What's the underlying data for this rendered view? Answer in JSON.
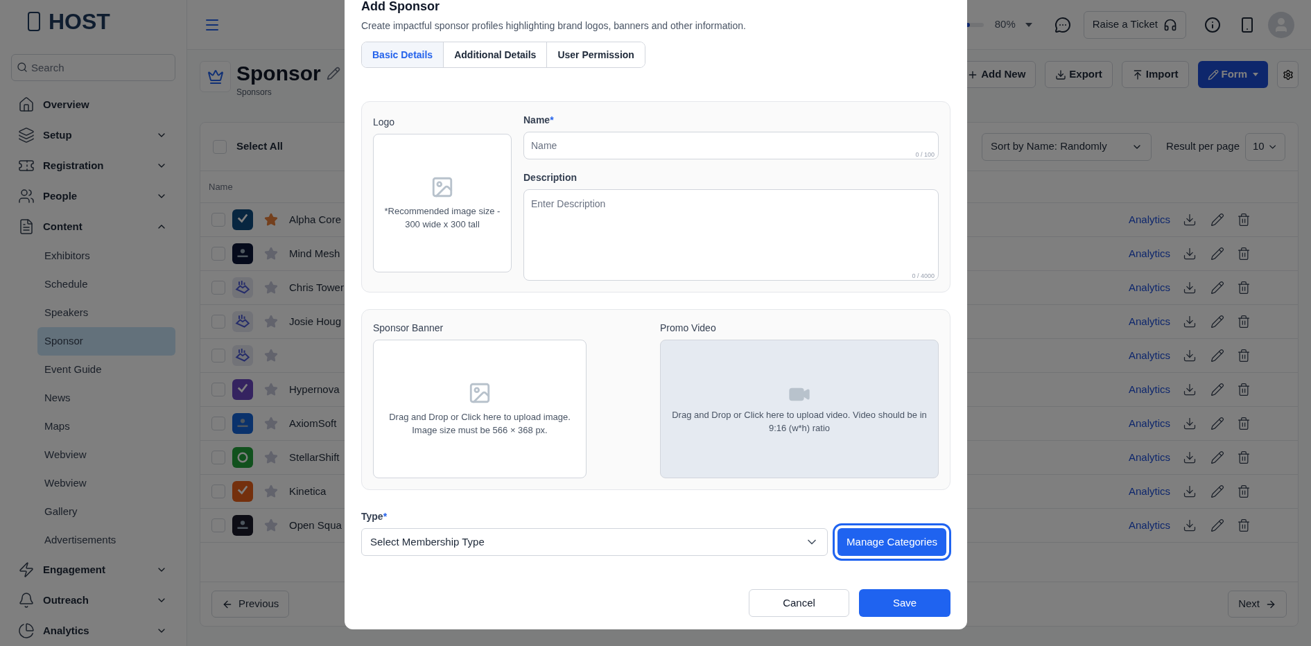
{
  "sidebar": {
    "brand": "HOST",
    "search": {
      "placeholder": "Search"
    },
    "items": [
      {
        "label": "Overview"
      },
      {
        "label": "Setup",
        "expanded": false
      },
      {
        "label": "Registration",
        "expanded": false
      },
      {
        "label": "People",
        "expanded": false
      },
      {
        "label": "Content",
        "expanded": true,
        "children": [
          {
            "label": "Exhibitors",
            "selected": false
          },
          {
            "label": "Schedule",
            "selected": false
          },
          {
            "label": "Speakers",
            "selected": false
          },
          {
            "label": "Sponsor",
            "selected": true
          },
          {
            "label": "Event Guide",
            "selected": false
          },
          {
            "label": "News",
            "selected": false
          },
          {
            "label": "Maps",
            "selected": false
          },
          {
            "label": "Webview",
            "selected": false
          },
          {
            "label": "Webview",
            "selected": false
          },
          {
            "label": "Gallery",
            "selected": false
          },
          {
            "label": "Advertisements",
            "selected": false
          }
        ]
      },
      {
        "label": "Engagement",
        "expanded": false
      },
      {
        "label": "Outreach",
        "expanded": false
      },
      {
        "label": "Analytics",
        "expanded": false
      }
    ]
  },
  "topbar": {
    "zoom": {
      "level": 0.8,
      "reading": "80%"
    },
    "ticket_button": "Raise a Ticket"
  },
  "page": {
    "title": "Sponsor",
    "subtitle": "Sponsors",
    "actions": [
      {
        "label": "Add New",
        "kind": "add"
      },
      {
        "label": "Export",
        "kind": "export"
      },
      {
        "label": "Import",
        "kind": "import"
      },
      {
        "label": "Form",
        "kind": "primary"
      }
    ]
  },
  "table": {
    "select_all": {
      "label": "Select All",
      "checked": false
    },
    "sort": "Sort by Name: Randomly",
    "per_page_label": "Result per page",
    "per_page": "10",
    "columns": [
      "Name"
    ],
    "rows": [
      {
        "name": "Alpha Core",
        "checked": false,
        "starred": true,
        "action": "Analytics"
      },
      {
        "name": "Mind Mesh",
        "checked": false,
        "starred": false,
        "action": "Analytics"
      },
      {
        "name": "Chris Tower",
        "checked": false,
        "starred": false,
        "action": "Analytics"
      },
      {
        "name": "Josie Houg",
        "checked": false,
        "starred": false,
        "action": "Analytics"
      },
      {
        "checked": false,
        "starred": false,
        "action": "Analytics"
      },
      {
        "name": "Hypernova",
        "checked": false,
        "starred": false,
        "action": "Analytics"
      },
      {
        "name": "AxiomSoft",
        "checked": false,
        "starred": false,
        "action": "Analytics"
      },
      {
        "name": "StellarShift",
        "checked": false,
        "starred": false,
        "action": "Analytics"
      },
      {
        "name": "Kinetica",
        "checked": false,
        "starred": false,
        "action": "Analytics"
      },
      {
        "name": "Open Squa",
        "checked": false,
        "starred": false,
        "action": "Analytics"
      }
    ],
    "previous": "Previous",
    "next": "Next"
  },
  "modal": {
    "title": "Add Sponsor",
    "subtitle": "Create impactful sponsor profiles highlighting brand logos, banners and other information.",
    "tabs": [
      {
        "label": "Basic Details",
        "selected": true
      },
      {
        "label": "Additional Details",
        "selected": false
      },
      {
        "label": "User Permission",
        "selected": false
      }
    ],
    "logo": {
      "label": "Logo",
      "hint": "*Recommended image size - 300 wide x 300 tall"
    },
    "name": {
      "label": "Name",
      "asterisk": "*",
      "placeholder": "Name",
      "counter": "0 / 100"
    },
    "description": {
      "label": "Description",
      "placeholder": "Enter Description",
      "counter": "0 / 4000"
    },
    "banner": {
      "label": "Sponsor Banner",
      "hint": "Drag and Drop or Click here to upload image. Image size must be 566 × 368 px."
    },
    "video": {
      "label": "Promo Video",
      "hint": "Drag and Drop or Click here to upload video. Video should be in 9:16 (w*h) ratio"
    },
    "type": {
      "label": "Type",
      "asterisk": "*",
      "value": "Select Membership Type"
    },
    "manage": "Manage Categories",
    "cancel": "Cancel",
    "save": "Save"
  }
}
